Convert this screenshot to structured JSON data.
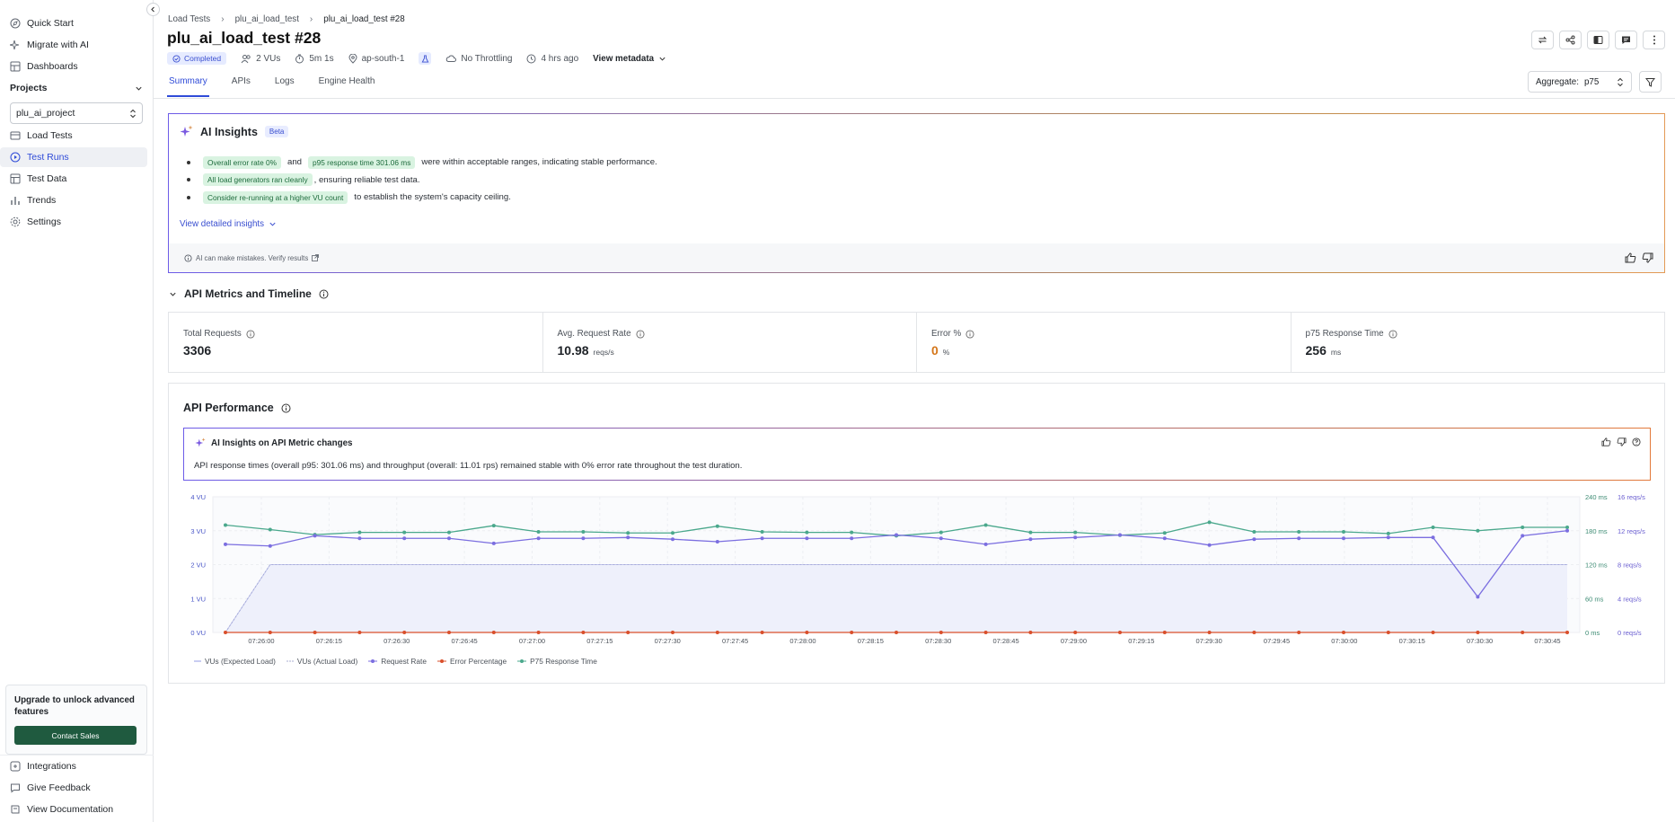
{
  "sidebar": {
    "top_items": [
      {
        "label": "Quick Start",
        "icon": "compass-icon"
      },
      {
        "label": "Migrate with AI",
        "icon": "sparkle-icon"
      },
      {
        "label": "Dashboards",
        "icon": "grid-icon"
      }
    ],
    "projects_label": "Projects",
    "project_value": "plu_ai_project",
    "project_items": [
      {
        "label": "Load Tests",
        "icon": "folder-icon"
      },
      {
        "label": "Test Runs",
        "icon": "play-circle-icon",
        "active": true
      },
      {
        "label": "Test Data",
        "icon": "table-icon"
      },
      {
        "label": "Trends",
        "icon": "bar-chart-icon"
      },
      {
        "label": "Settings",
        "icon": "gear-icon"
      }
    ],
    "upgrade_text": "Upgrade to unlock advanced features",
    "contact_label": "Contact Sales",
    "bottom_items": [
      {
        "label": "Integrations",
        "icon": "plug-icon"
      },
      {
        "label": "Give Feedback",
        "icon": "message-icon"
      },
      {
        "label": "View Documentation",
        "icon": "book-icon"
      }
    ]
  },
  "header": {
    "breadcrumb": [
      "Load Tests",
      "plu_ai_load_test",
      "plu_ai_load_test #28"
    ],
    "title": "plu_ai_load_test #28",
    "status": "Completed",
    "vus": "2 VUs",
    "duration": "5m 1s",
    "region": "ap-south-1",
    "throttling": "No Throttling",
    "time_ago": "4 hrs ago",
    "view_metadata": "View metadata",
    "tabs": [
      "Summary",
      "APIs",
      "Logs",
      "Engine Health"
    ],
    "active_tab": "Summary",
    "aggregate_label": "Aggregate:",
    "aggregate_value": "p75"
  },
  "ai_insights": {
    "title": "AI Insights",
    "beta": "Beta",
    "bullet1": {
      "pill1": "Overall error rate 0%",
      "and": "and",
      "pill2": "p95 response time 301.06 ms",
      "rest": "were within acceptable ranges, indicating stable performance."
    },
    "bullet2": {
      "pill": "All load generators ran cleanly",
      "rest": ", ensuring reliable test data."
    },
    "bullet3": {
      "pill": "Consider re-running at a higher VU count",
      "rest": "to establish the system's capacity ceiling."
    },
    "detail_link": "View detailed insights",
    "disclaimer": "AI can make mistakes. Verify results"
  },
  "metrics_section": {
    "title": "API Metrics and Timeline",
    "cards": [
      {
        "label": "Total Requests",
        "value": "3306",
        "unit": ""
      },
      {
        "label": "Avg. Request Rate",
        "value": "10.98",
        "unit": "reqs/s"
      },
      {
        "label": "Error %",
        "value": "0",
        "unit": "%"
      },
      {
        "label": "p75 Response Time",
        "value": "256",
        "unit": "ms"
      }
    ]
  },
  "performance": {
    "title": "API Performance",
    "ai_title": "AI Insights on API Metric changes",
    "ai_text": "API response times (overall p95: 301.06 ms) and throughput (overall: 11.01 rps) remained stable with 0% error rate throughout the test duration."
  },
  "colors": {
    "accent": "#2f4bd8",
    "request_rate": "#7b6ee0",
    "p75": "#4aa88c",
    "error": "#d94f2b",
    "vus": "#c9cdf2"
  },
  "chart_data": {
    "type": "line",
    "x": [
      "07:25:50",
      "07:26:00",
      "07:26:10",
      "07:26:20",
      "07:26:30",
      "07:26:40",
      "07:26:50",
      "07:27:00",
      "07:27:10",
      "07:27:20",
      "07:27:30",
      "07:27:40",
      "07:27:50",
      "07:28:00",
      "07:28:10",
      "07:28:20",
      "07:28:30",
      "07:28:40",
      "07:28:50",
      "07:29:00",
      "07:29:10",
      "07:29:20",
      "07:29:30",
      "07:29:40",
      "07:29:50",
      "07:30:00",
      "07:30:10",
      "07:30:20",
      "07:30:30",
      "07:30:40",
      "07:30:50"
    ],
    "tick_labels": [
      "07:26:00",
      "07:26:15",
      "07:26:30",
      "07:26:45",
      "07:27:00",
      "07:27:15",
      "07:27:30",
      "07:27:45",
      "07:28:00",
      "07:28:15",
      "07:28:30",
      "07:28:45",
      "07:29:00",
      "07:29:15",
      "07:29:30",
      "07:29:45",
      "07:30:00",
      "07:30:15",
      "07:30:30",
      "07:30:45"
    ],
    "y_left_ticks": [
      "0 VU",
      "1 VU",
      "2 VU",
      "3 VU",
      "4 VU"
    ],
    "y_mid_ticks": [
      "0 ms",
      "60 ms",
      "120 ms",
      "180 ms",
      "240 ms"
    ],
    "y_right_ticks": [
      "0 reqs/s",
      "4 reqs/s",
      "8 reqs/s",
      "12 reqs/s",
      "16 reqs/s"
    ],
    "series": [
      {
        "name": "VUs (Expected Load)",
        "values": [
          0,
          2,
          2,
          2,
          2,
          2,
          2,
          2,
          2,
          2,
          2,
          2,
          2,
          2,
          2,
          2,
          2,
          2,
          2,
          2,
          2,
          2,
          2,
          2,
          2,
          2,
          2,
          2,
          2,
          2,
          2
        ]
      },
      {
        "name": "VUs (Actual Load)",
        "values": [
          0,
          2,
          2,
          2,
          2,
          2,
          2,
          2,
          2,
          2,
          2,
          2,
          2,
          2,
          2,
          2,
          2,
          2,
          2,
          2,
          2,
          2,
          2,
          2,
          2,
          2,
          2,
          2,
          2,
          2,
          2
        ]
      },
      {
        "name": "Request Rate",
        "values": [
          10.4,
          10.2,
          11.4,
          11.1,
          11.1,
          11.1,
          10.5,
          11.1,
          11.1,
          11.2,
          11.0,
          10.7,
          11.1,
          11.1,
          11.1,
          11.5,
          11.1,
          10.4,
          11.0,
          11.2,
          11.5,
          11.1,
          10.3,
          11.0,
          11.1,
          11.1,
          11.2,
          11.2,
          4.2,
          11.4,
          12.0
        ]
      },
      {
        "name": "Error Percentage",
        "values": [
          0,
          0,
          0,
          0,
          0,
          0,
          0,
          0,
          0,
          0,
          0,
          0,
          0,
          0,
          0,
          0,
          0,
          0,
          0,
          0,
          0,
          0,
          0,
          0,
          0,
          0,
          0,
          0,
          0,
          0,
          0
        ]
      },
      {
        "name": "P75 Response Time",
        "values": [
          190,
          182,
          173,
          177,
          177,
          177,
          189,
          178,
          178,
          176,
          176,
          188,
          178,
          177,
          177,
          171,
          177,
          190,
          177,
          177,
          172,
          176,
          195,
          178,
          178,
          178,
          175,
          186,
          180,
          186,
          186
        ]
      }
    ]
  }
}
